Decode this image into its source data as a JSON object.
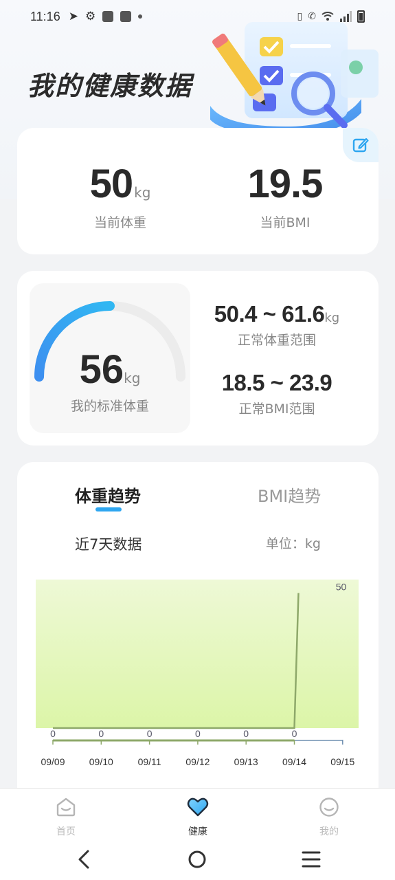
{
  "status_bar": {
    "time": "11:16"
  },
  "page": {
    "title": "我的健康数据"
  },
  "summary": {
    "weight_value": "50",
    "weight_unit": "kg",
    "weight_label": "当前体重",
    "bmi_value": "19.5",
    "bmi_label": "当前BMI"
  },
  "standard": {
    "value": "56",
    "unit": "kg",
    "label": "我的标准体重",
    "gauge_fill_fraction": 0.5,
    "weight_range": "50.4 ~ 61.6",
    "weight_range_unit": "kg",
    "weight_range_label": "正常体重范围",
    "bmi_range": "18.5 ~ 23.9",
    "bmi_range_label": "正常BMI范围"
  },
  "trend": {
    "tabs": [
      "体重趋势",
      "BMI趋势"
    ],
    "active_tab": "体重趋势",
    "period_label": "近7天数据",
    "unit_label": "单位：kg"
  },
  "chart_data": {
    "type": "area",
    "categories": [
      "09/09",
      "09/10",
      "09/11",
      "09/12",
      "09/13",
      "09/14",
      "09/15"
    ],
    "values": [
      0,
      0,
      0,
      0,
      0,
      0,
      50
    ],
    "data_labels": [
      "0",
      "0",
      "0",
      "0",
      "0",
      "0",
      "50"
    ],
    "ylim": [
      0,
      55
    ],
    "colors": {
      "fill_top": "#eef9d6",
      "fill_bottom": "#dcf5a8",
      "line": "#8ea86a",
      "axis": "#6f8fb0"
    }
  },
  "nav": {
    "items": [
      {
        "label": "首页",
        "icon": "home-icon"
      },
      {
        "label": "健康",
        "icon": "heart-icon"
      },
      {
        "label": "我的",
        "icon": "smile-icon"
      }
    ],
    "active": "健康"
  },
  "colors": {
    "accent": "#2ea6f0",
    "gauge_track": "#eeeeee"
  }
}
